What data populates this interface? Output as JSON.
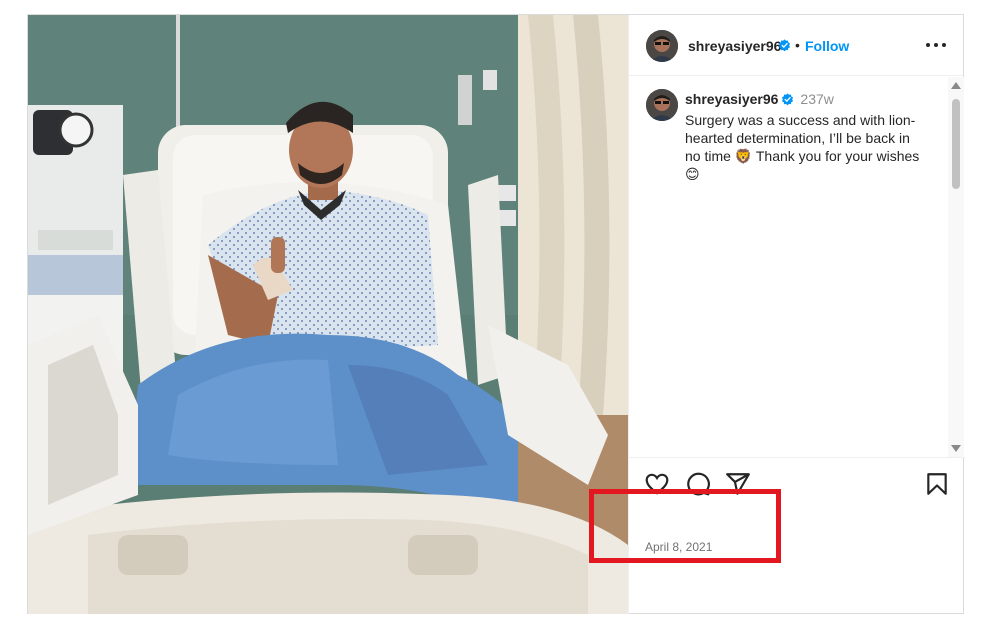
{
  "post": {
    "author": {
      "username": "shreyasiyer96",
      "verified": true,
      "avatar_icon": "avatar-image"
    },
    "follow_label": "Follow",
    "separator": "•",
    "caption": {
      "username": "shreyasiyer96",
      "time_ago": "237w",
      "text": "Surgery was a success and with lion-\nhearted determination, I’ll be back in\nno time 🦁  Thank you for your wishes\n😊"
    },
    "actions": {
      "like_icon": "heart-icon",
      "comment_icon": "comment-icon",
      "share_icon": "send-icon",
      "save_icon": "bookmark-icon"
    },
    "date": "April 8, 2021"
  },
  "colors": {
    "accent": "#0095f6",
    "verified_badge": "#0095f6",
    "highlight": "#e3171f",
    "muted_text": "#737373"
  }
}
